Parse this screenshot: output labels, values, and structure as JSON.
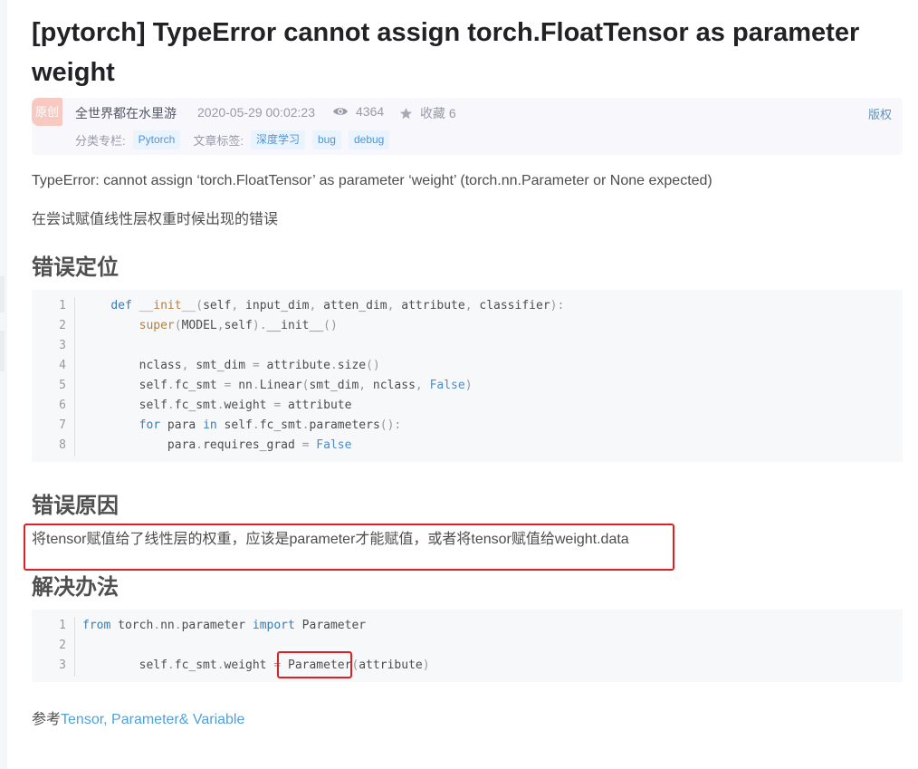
{
  "article": {
    "title": "[pytorch] TypeError cannot assign torch.FloatTensor as parameter weight",
    "meta": {
      "badge": "原创",
      "author": "全世界都在水里游",
      "date": "2020-05-29 00:02:23",
      "views": "4364",
      "favorites": "收藏 6",
      "copyright": "版权",
      "category_label": "分类专栏:",
      "categories": [
        "Pytorch"
      ],
      "tags_label": "文章标签:",
      "tags": [
        "深度学习",
        "bug",
        "debug"
      ]
    },
    "intro_error": "TypeError: cannot assign ‘torch.FloatTensor’ as parameter ‘weight’ (torch.nn.Parameter or None expected)",
    "intro_context": "在尝试赋值线性层权重时候出现的错误",
    "section1": {
      "heading": "错误定位",
      "code": {
        "line_numbers": [
          "1",
          "2",
          "3",
          "4",
          "5",
          "6",
          "7",
          "8"
        ]
      }
    },
    "section2": {
      "heading": "错误原因",
      "text": "将tensor赋值给了线性层的权重，应该是parameter才能赋值，或者将tensor赋值给weight.data"
    },
    "section3": {
      "heading": "解决办法",
      "code": {
        "line_numbers": [
          "1",
          "2",
          "3"
        ]
      }
    },
    "reference": {
      "prefix": "参考",
      "link_text": "Tensor, Parameter& Variable"
    }
  },
  "colors": {
    "accent_link": "#4ea1db",
    "highlight_box": "#e02020",
    "badge": "#f7c9c0"
  }
}
